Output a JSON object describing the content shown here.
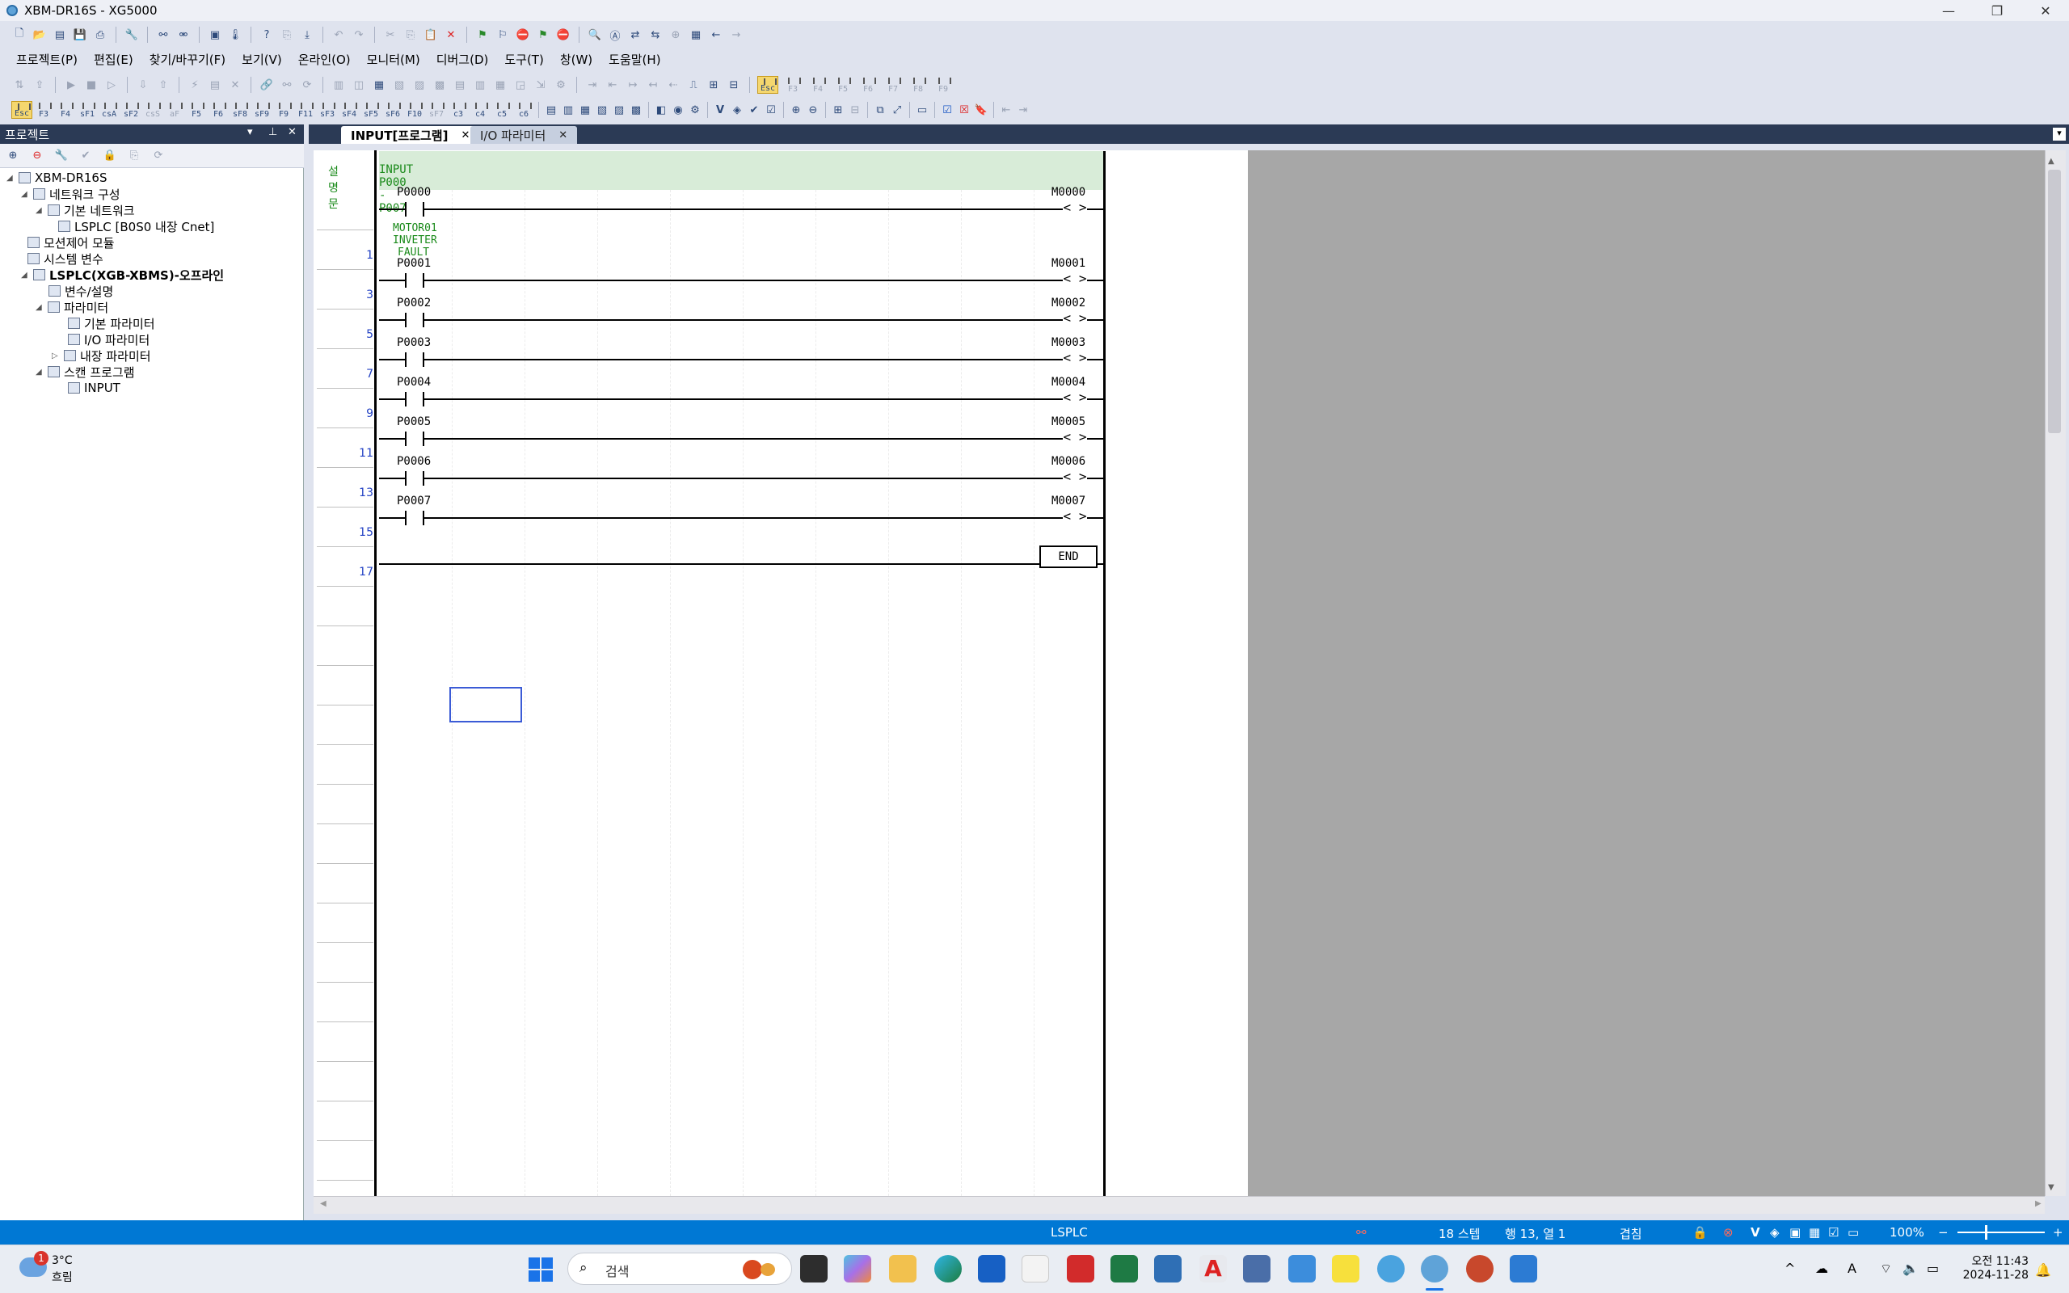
{
  "window": {
    "title": "XBM-DR16S - XG5000"
  },
  "menu": [
    "프로젝트(P)",
    "편집(E)",
    "찾기/바꾸기(F)",
    "보기(V)",
    "온라인(O)",
    "모니터(M)",
    "디버그(D)",
    "도구(T)",
    "창(W)",
    "도움말(H)"
  ],
  "fkeys": [
    "Esc",
    "F3",
    "F4",
    "sF1",
    "csA",
    "sF2",
    "csS",
    "aF",
    "F5",
    "F6",
    "sF8",
    "sF9",
    "F9",
    "F11",
    "sF3",
    "sF4",
    "sF5",
    "sF6",
    "F10",
    "sF7",
    "c3",
    "c4",
    "c5",
    "c6"
  ],
  "fkeys2": [
    "Esc",
    "F3",
    "F4",
    "F5",
    "F6",
    "F7",
    "F8",
    "F9"
  ],
  "project_panel": {
    "title": "프로젝트",
    "tree": [
      {
        "label": "XBM-DR16S"
      },
      {
        "label": "네트워크 구성"
      },
      {
        "label": "기본 네트워크"
      },
      {
        "label": "LSPLC [B0S0 내장 Cnet]"
      },
      {
        "label": "모션제어 모듈"
      },
      {
        "label": "시스템 변수"
      },
      {
        "label": "LSPLC(XGB-XBMS)-오프라인"
      },
      {
        "label": "변수/설명"
      },
      {
        "label": "파라미터"
      },
      {
        "label": "기본 파라미터"
      },
      {
        "label": "I/O 파라미터"
      },
      {
        "label": "내장 파라미터"
      },
      {
        "label": "스캔 프로그램"
      },
      {
        "label": "INPUT"
      }
    ]
  },
  "tabs": [
    {
      "label": "INPUT[프로그램]",
      "active": true
    },
    {
      "label": "I/O 파라미터",
      "active": false
    }
  ],
  "ladder": {
    "comment_label": "설명문",
    "comment_text": "INPUT P000 - P007",
    "rung_comment": [
      "MOTOR01",
      "INVETER",
      "FAULT"
    ],
    "rungs": [
      {
        "step": "1",
        "contact": "P0000",
        "coil": "M0000"
      },
      {
        "step": "3",
        "contact": "P0001",
        "coil": "M0001"
      },
      {
        "step": "5",
        "contact": "P0002",
        "coil": "M0002"
      },
      {
        "step": "7",
        "contact": "P0003",
        "coil": "M0003"
      },
      {
        "step": "9",
        "contact": "P0004",
        "coil": "M0004"
      },
      {
        "step": "11",
        "contact": "P0005",
        "coil": "M0005"
      },
      {
        "step": "13",
        "contact": "P0006",
        "coil": "M0006"
      },
      {
        "step": "15",
        "contact": "P0007",
        "coil": "M0007"
      }
    ],
    "end_step": "17",
    "end_label": "END",
    "coil_symbol": "< >"
  },
  "status": {
    "plc": "LSPLC",
    "steps": "18 스텝",
    "position": "행 13, 열 1",
    "mode": "겹침",
    "zoom": "100%"
  },
  "taskbar": {
    "weather_temp": "3°C",
    "weather_text": "흐림",
    "weather_badge": "1",
    "search_placeholder": "검색",
    "time": "오전 11:43",
    "date": "2024-11-28"
  },
  "colors": {
    "accent": "#0078d4",
    "tab_bar": "#2b3a55",
    "comment_bg": "#d8ecd8",
    "line_number": "#2342c4"
  }
}
